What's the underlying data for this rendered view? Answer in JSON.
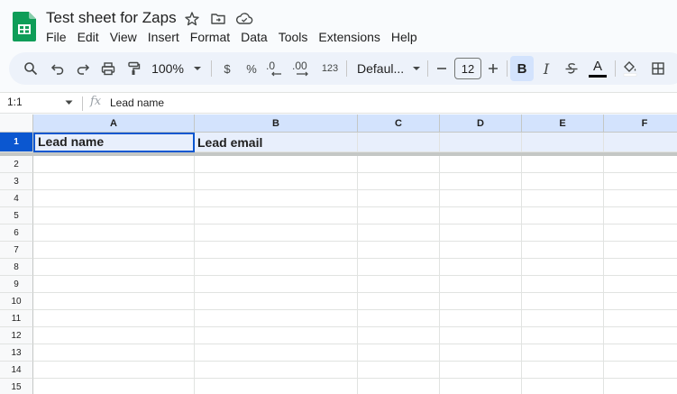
{
  "app": {
    "title": "Test sheet for Zaps",
    "brand_color": "#0f9d58"
  },
  "menu": [
    "File",
    "Edit",
    "View",
    "Insert",
    "Format",
    "Data",
    "Tools",
    "Extensions",
    "Help"
  ],
  "toolbar": {
    "zoom": "100%",
    "currency": "$",
    "percent": "%",
    "decrease_decimal": ".0",
    "increase_decimal": ".00",
    "more_formats": "123",
    "font": "Defaul...",
    "font_size": "12",
    "bold": "B",
    "italic": "I",
    "text_color_letter": "A",
    "text_color": "#000000",
    "bold_active": true
  },
  "formula_bar": {
    "name_box": "1:1",
    "fx": "fx",
    "value": "Lead name"
  },
  "grid": {
    "columns": [
      "A",
      "B",
      "C",
      "D",
      "E",
      "F"
    ],
    "rows": [
      "1",
      "2",
      "3",
      "4",
      "5",
      "6",
      "7",
      "8",
      "9",
      "10",
      "11",
      "12",
      "13",
      "14",
      "15"
    ],
    "selected_row": "1",
    "row1": [
      "Lead name",
      "Lead email",
      "",
      "",
      "",
      ""
    ]
  }
}
